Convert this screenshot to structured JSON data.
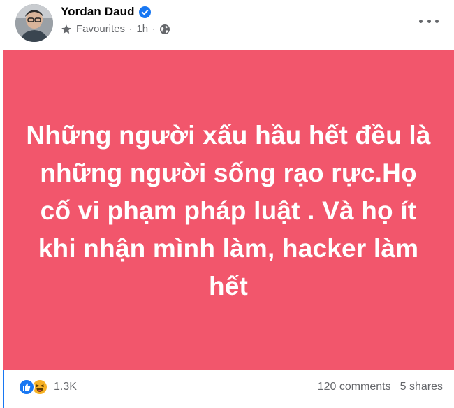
{
  "header": {
    "author_name": "Yordan Daud",
    "audience_label": "Favourites",
    "time_ago": "1h",
    "separator": "·"
  },
  "post": {
    "background_color": "#f2566c",
    "text_color": "#ffffff",
    "text": "Những người xấu hầu hết đều là những người sống rạo rực.Họ cố vi phạm pháp luật . Và họ ít khi nhận mình làm, hacker làm hết"
  },
  "footer": {
    "reaction_icons": [
      "like-icon",
      "haha-icon"
    ],
    "reaction_count": "1.3K",
    "comments": "120 comments",
    "shares": "5 shares"
  },
  "colors": {
    "accent": "#1877f2",
    "secondary_text": "#65676b"
  }
}
